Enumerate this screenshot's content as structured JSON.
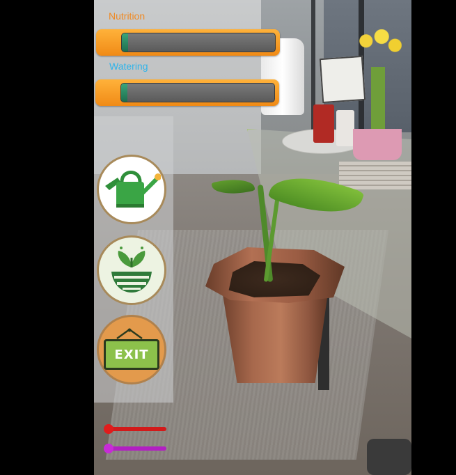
{
  "hud": {
    "nutrition": {
      "label": "Nutrition",
      "level": 0.04
    },
    "watering": {
      "label": "Watering",
      "level": 0.04
    }
  },
  "actions": {
    "water": {
      "icon": "watering-can-icon"
    },
    "fertilize": {
      "icon": "plant-soil-icon"
    },
    "exit": {
      "icon": "exit-sign-icon",
      "sign_text": "EXIT"
    }
  },
  "sliders": {
    "red": {
      "color": "#d21a1a",
      "value": 0
    },
    "purple": {
      "color": "#b21fc2",
      "value": 0
    }
  },
  "colors": {
    "nutrition_label": "#f08a23",
    "watering_label": "#2fb4ea",
    "bar_frame": "#f08a16",
    "bar_fill": "#2e8a62"
  }
}
